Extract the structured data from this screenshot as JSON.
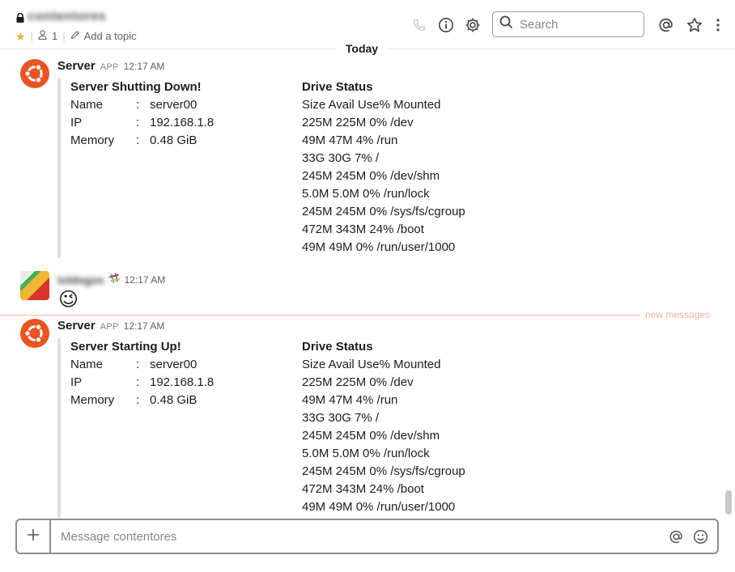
{
  "header": {
    "channel_name": "contentores",
    "member_count": "1",
    "add_topic_label": "Add a topic",
    "search_placeholder": "Search"
  },
  "day_divider": "Today",
  "new_messages_label": "new messages",
  "messages": [
    {
      "sender": "Server",
      "badge": "APP",
      "time": "12:17 AM",
      "attachment": {
        "title": "Server Shutting Down!",
        "fields": [
          {
            "key": "Name",
            "sep": ":",
            "value": "server00"
          },
          {
            "key": "IP",
            "sep": ":",
            "value": "192.168.1.8"
          },
          {
            "key": "Memory",
            "sep": ":",
            "value": "0.48 GiB"
          }
        ],
        "drive_title": "Drive Status",
        "drive_lines": [
          "Size Avail Use% Mounted",
          "225M 225M 0% /dev",
          "49M 47M 4% /run",
          "33G 30G 7% /",
          "245M 245M 0% /dev/shm",
          "5.0M 5.0M 0% /run/lock",
          "245M 245M 0% /sys/fs/cgroup",
          "472M 343M 24% /boot",
          "49M 49M 0% /run/user/1000"
        ]
      }
    },
    {
      "sender": "loldogzo",
      "time": "12:17 AM",
      "text": "😉"
    },
    {
      "sender": "Server",
      "badge": "APP",
      "time": "12:17 AM",
      "attachment": {
        "title": "Server Starting Up!",
        "fields": [
          {
            "key": "Name",
            "sep": ":",
            "value": "server00"
          },
          {
            "key": "IP",
            "sep": ":",
            "value": "192.168.1.8"
          },
          {
            "key": "Memory",
            "sep": ":",
            "value": "0.48 GiB"
          }
        ],
        "drive_title": "Drive Status",
        "drive_lines": [
          "Size Avail Use% Mounted",
          "225M 225M 0% /dev",
          "49M 47M 4% /run",
          "33G 30G 7% /",
          "245M 245M 0% /dev/shm",
          "5.0M 5.0M 0% /run/lock",
          "245M 245M 0% /sys/fs/cgroup",
          "472M 343M 24% /boot",
          "49M 49M 0% /run/user/1000"
        ]
      }
    }
  ],
  "composer": {
    "placeholder": "Message contentores"
  },
  "colors": {
    "star": "#ecb22e",
    "ubuntu_orange": "#e95420",
    "new_messages_line": "#f3b8a3"
  },
  "icons": [
    "lock-icon",
    "star-icon",
    "person-icon",
    "pencil-icon",
    "phone-icon",
    "info-icon",
    "gear-icon",
    "search-icon",
    "at-icon",
    "star-outline-icon",
    "more-icon",
    "plus-icon",
    "emoji-icon"
  ]
}
